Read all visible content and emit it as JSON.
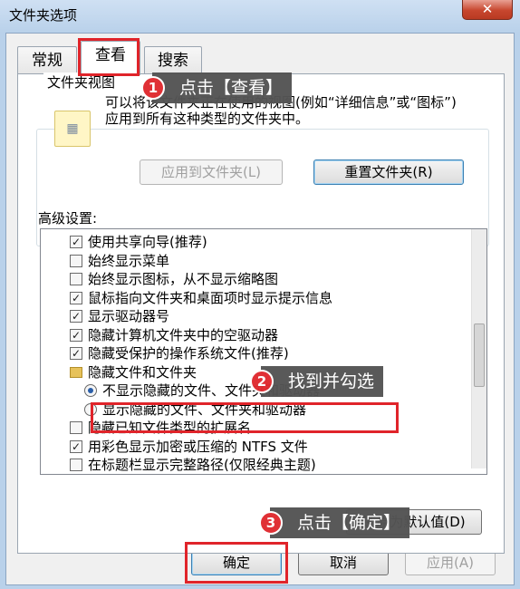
{
  "window": {
    "title": "文件夹选项",
    "close_glyph": "✕"
  },
  "tabs": [
    {
      "label": "常规"
    },
    {
      "label": "查看"
    },
    {
      "label": "搜索"
    }
  ],
  "folder_views": {
    "group_title": "文件夹视图",
    "icon": "folder-view-icon",
    "description": "可以将该文件夹正在使用的视图(例如“详细信息”或“图标”)应用到所有这种类型的文件夹中。",
    "apply_button": "应用到文件夹(L)",
    "reset_button": "重置文件夹(R)"
  },
  "advanced": {
    "label": "高级设置:",
    "rows": [
      {
        "type": "checkbox",
        "checked": true,
        "text": "使用共享向导(推荐)"
      },
      {
        "type": "checkbox",
        "checked": false,
        "text": "始终显示菜单"
      },
      {
        "type": "checkbox",
        "checked": false,
        "text": "始终显示图标，从不显示缩略图"
      },
      {
        "type": "checkbox",
        "checked": true,
        "text": "鼠标指向文件夹和桌面项时显示提示信息"
      },
      {
        "type": "checkbox",
        "checked": true,
        "text": "显示驱动器号"
      },
      {
        "type": "checkbox",
        "checked": true,
        "text": "隐藏计算机文件夹中的空驱动器"
      },
      {
        "type": "checkbox",
        "checked": true,
        "text": "隐藏受保护的操作系统文件(推荐)"
      },
      {
        "type": "folder",
        "text": "隐藏文件和文件夹"
      },
      {
        "type": "radio",
        "checked": true,
        "text": "不显示隐藏的文件、文件夹和驱动器"
      },
      {
        "type": "radio",
        "checked": false,
        "text": "显示隐藏的文件、文件夹和驱动器"
      },
      {
        "type": "checkbox",
        "checked": false,
        "text": "隐藏已知文件类型的扩展名"
      },
      {
        "type": "checkbox",
        "checked": true,
        "text": "用彩色显示加密或压缩的 NTFS 文件"
      },
      {
        "type": "checkbox",
        "checked": false,
        "text": "在标题栏显示完整路径(仅限经典主题)"
      }
    ]
  },
  "buttons": {
    "restore_defaults": "还原为默认值(D)",
    "ok": "确定",
    "cancel": "取消",
    "apply": "应用(A)"
  },
  "annotations": [
    {
      "number": "1",
      "text": "点击【查看】"
    },
    {
      "number": "2",
      "text": "找到并勾选"
    },
    {
      "number": "3",
      "text": "点击【确定】"
    }
  ],
  "colors": {
    "highlight_red": "#e0242a",
    "callout_bg": "#545454"
  }
}
